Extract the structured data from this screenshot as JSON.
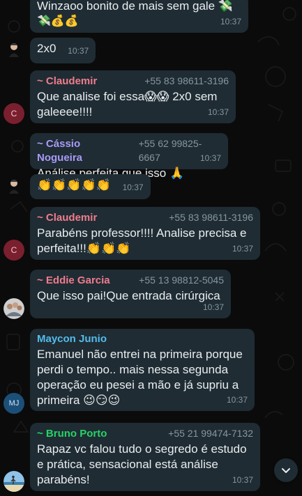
{
  "colors": {
    "background": "#0b0b0b",
    "bubble": "#1f2c34",
    "name_claudemir": "#f07c8c",
    "name_cassio": "#a99af6",
    "name_eddie": "#f07c8c",
    "name_maycon": "#53bdeb",
    "name_bruno": "#25d366",
    "timestamp": "#8696a0"
  },
  "messages": [
    {
      "text_line1": "Winzaoo bonito de mais sem gale 💸",
      "text_line2": "💸💰💰",
      "time": "10:37"
    },
    {
      "text": "2x0",
      "time": "10:37",
      "avatar_icon": "person-avatar-icon"
    },
    {
      "sender": "~ Claudemir",
      "phone": "+55 83 98611-3196",
      "text": "Que analise foi essa😱😱 2x0 sem\ngaleeee!!!!",
      "time": "10:37",
      "avatar_letter": "C"
    },
    {
      "sender": "~ Cássio Nogueira",
      "phone": "+55 62 99825-6667",
      "text": "Análise perfeita que isso 🙏",
      "time": "10:37"
    },
    {
      "text": "👏👏👏👏👏",
      "time": "10:37",
      "avatar_icon": "person-avatar-icon"
    },
    {
      "sender": "~ Claudemir",
      "phone": "+55 83 98611-3196",
      "text": "Parabéns professor!!!! Analise precisa e\nperfeita!!!👏👏👏",
      "time": "10:37",
      "avatar_letter": "C"
    },
    {
      "sender": "~ Eddie Garcia",
      "phone": "+55 13 98812-5045",
      "text": "Que isso pai!Que entrada cirúrgica",
      "time": "10:37",
      "avatar_icon": "group-photo-avatar-icon"
    },
    {
      "sender": "Maycon Junio",
      "text": "Emanuel não entrei na primeira porque\nperdi o tempo.. mais nessa segunda\noperação eu pesei a mão e já supriu a\nprimeira 😉😏😉",
      "time": "10:37",
      "avatar_letter": "MJ"
    },
    {
      "sender": "~ Bruno Porto",
      "phone": "+55 21 99474-7132",
      "text": "Rapaz vc falou tudo o segredo é estudo\ne prática, sensacional está análise\nparabéns!",
      "time": "10:37",
      "avatar_icon": "beach-photo-avatar-icon"
    }
  ],
  "scroll_button_icon": "chevron-down-icon"
}
